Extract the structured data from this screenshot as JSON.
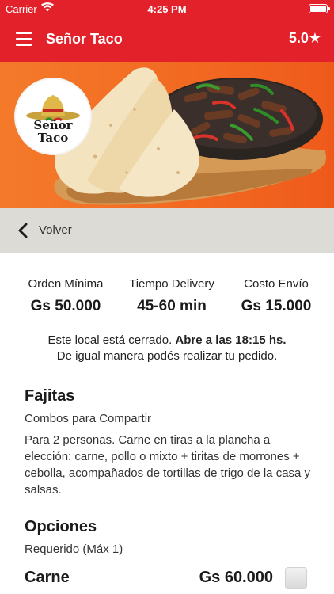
{
  "statusbar": {
    "carrier": "Carrier",
    "time": "4:25 PM"
  },
  "navbar": {
    "title": "Señor Taco",
    "rating": "5.0★"
  },
  "hero": {
    "logo_text_line1": "Señor",
    "logo_text_line2": "Taco"
  },
  "back": {
    "label": "Volver"
  },
  "info": {
    "min_order_label": "Orden Mínima",
    "min_order_value": "Gs 50.000",
    "delivery_time_label": "Tiempo Delivery",
    "delivery_time_value": "45-60 min",
    "shipping_label": "Costo Envío",
    "shipping_value": "Gs 15.000"
  },
  "notice": {
    "closed_text": "Este local está cerrado. ",
    "opens_text": "Abre a las 18:15 hs.",
    "line2": "De igual manera podés realizar tu pedido."
  },
  "product": {
    "name": "Fajitas",
    "category": "Combos para Compartir",
    "description": "Para 2 personas. Carne en tiras a la plancha a elección: carne, pollo o mixto + tiritas de morrones + cebolla, acompañados de tortillas de trigo de la casa y salsas."
  },
  "options": {
    "title": "Opciones",
    "requirement": "Requerido (Máx 1)",
    "items": [
      {
        "name": "Carne",
        "price": "Gs 60.000"
      }
    ]
  },
  "colors": {
    "brand_red": "#e3212b",
    "hero_orange": "#f26a22",
    "backbar_gray": "#dcdbd6"
  },
  "icons": {
    "menu": "hamburger-icon",
    "back": "chevron-left-icon",
    "wifi": "wifi-icon",
    "battery": "battery-icon"
  }
}
